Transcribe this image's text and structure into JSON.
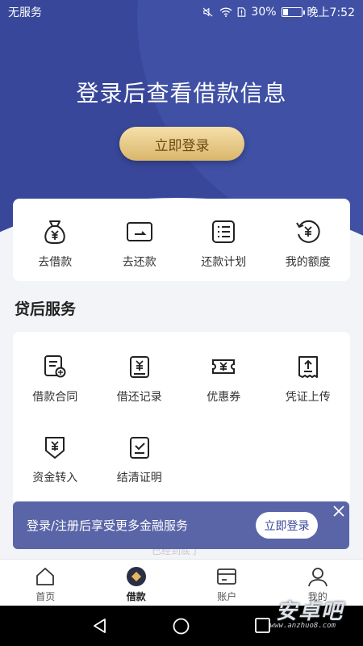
{
  "status_bar": {
    "carrier": "无服务",
    "battery": "30%",
    "battery_level": 0.3,
    "time": "晚上7:52"
  },
  "hero": {
    "title": "登录后查看借款信息",
    "login_label": "立即登录"
  },
  "quick_actions": [
    {
      "label": "去借款",
      "icon": "money-bag-icon"
    },
    {
      "label": "去还款",
      "icon": "card-icon"
    },
    {
      "label": "还款计划",
      "icon": "list-icon"
    },
    {
      "label": "我的额度",
      "icon": "quota-refresh-icon"
    }
  ],
  "services": {
    "title": "贷后服务",
    "items": [
      {
        "label": "借款合同",
        "icon": "contract-icon"
      },
      {
        "label": "借还记录",
        "icon": "record-icon"
      },
      {
        "label": "优惠券",
        "icon": "coupon-icon"
      },
      {
        "label": "凭证上传",
        "icon": "upload-icon"
      },
      {
        "label": "资金转入",
        "icon": "transfer-in-icon"
      },
      {
        "label": "结清证明",
        "icon": "certificate-icon"
      }
    ]
  },
  "banner": {
    "text": "登录/注册后享受更多金融服务",
    "button": "立即登录"
  },
  "faded_text": "已经到底了",
  "tabs": [
    {
      "label": "首页",
      "icon": "home-icon",
      "active": false
    },
    {
      "label": "借款",
      "icon": "loan-icon",
      "active": true
    },
    {
      "label": "账户",
      "icon": "account-card-icon",
      "active": false
    },
    {
      "label": "我的",
      "icon": "user-icon",
      "active": false
    }
  ],
  "watermark": {
    "main": "安卓吧",
    "sub": "www.anzhuo8.com"
  },
  "colors": {
    "primary": "#38479a",
    "gold": "#d9b66b",
    "banner": "#5a65a8",
    "background": "#f3f4f7"
  }
}
